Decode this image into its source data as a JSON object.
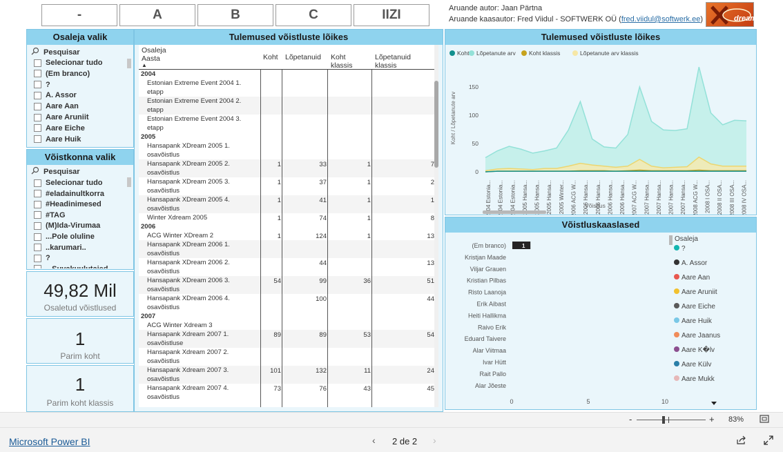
{
  "top_buttons": [
    "-",
    "A",
    "B",
    "C",
    "IIZI"
  ],
  "author": {
    "line1": "Aruande autor: Jaan Pärtna",
    "line2_prefix": "Aruande kaasautor: Fred Viidul - SOFTWERK OÜ (",
    "email": "fred.viidul@softwerk.ee",
    "line2_suffix": ")"
  },
  "logo_text": "dream",
  "participant_slicer": {
    "title": "Osaleja valik",
    "search": "Pesquisar",
    "items": [
      "Selecionar tudo",
      "(Em branco)",
      "?",
      "A. Assor",
      "Aare Aan",
      "Aare Aruniit",
      "Aare Eiche",
      "Aare Huik"
    ]
  },
  "competition_slicer": {
    "title": "Võistkonna valik",
    "search": "Pesquisar",
    "items": [
      "Selecionar tudo",
      "#eladainultkorra",
      "#Headinimesed",
      "#TAG",
      "(M)Ida-Virumaa",
      "...Pole oluline",
      "..karumari..",
      "?",
      "...Suvakuulutaied ..."
    ]
  },
  "kpis": [
    {
      "value": "49,82 Mil",
      "label": "Osaletud võistlused"
    },
    {
      "value": "1",
      "label": "Parim koht"
    },
    {
      "value": "1",
      "label": "Parim koht klassis"
    }
  ],
  "table": {
    "title": "Tulemused võistluste lõikes",
    "header_col1_line1": "Osaleja",
    "header_col1_line2": "Aasta",
    "columns": [
      "Koht",
      "Lõpetanuid",
      "Koht klassis",
      "Lõpetanuid klassis"
    ],
    "rows": [
      {
        "type": "year",
        "label": "2004"
      },
      {
        "type": "event",
        "label": "Estonian Extreme Event 2004 1.",
        "label2": "etapp",
        "vals": [
          "",
          "",
          "",
          ""
        ]
      },
      {
        "type": "event",
        "label": "Estonian Extreme Event 2004 2.",
        "label2": "etapp",
        "vals": [
          "",
          "",
          "",
          ""
        ]
      },
      {
        "type": "event",
        "label": "Estonian Extreme Event 2004 3.",
        "label2": "etapp",
        "vals": [
          "",
          "",
          "",
          ""
        ]
      },
      {
        "type": "year",
        "label": "2005"
      },
      {
        "type": "event",
        "label": "Hansapank XDream 2005 1.",
        "label2": "osavõistlus",
        "vals": [
          "",
          "",
          "",
          ""
        ]
      },
      {
        "type": "event",
        "label": "Hansapank XDream 2005 2.",
        "label2": "osavõistlus",
        "vals": [
          "1",
          "33",
          "1",
          "7"
        ]
      },
      {
        "type": "event",
        "label": "Hansapank XDream 2005 3.",
        "label2": "osavõistlus",
        "vals": [
          "1",
          "37",
          "1",
          "2"
        ]
      },
      {
        "type": "event",
        "label": "Hansapank XDream 2005 4.",
        "label2": "osavõistlus",
        "vals": [
          "1",
          "41",
          "1",
          "1"
        ]
      },
      {
        "type": "event1",
        "label": "Winter Xdream 2005",
        "vals": [
          "1",
          "74",
          "1",
          "8"
        ]
      },
      {
        "type": "year",
        "label": "2006"
      },
      {
        "type": "event1",
        "label": "ACG Winter XDream 2",
        "vals": [
          "1",
          "124",
          "1",
          "13"
        ]
      },
      {
        "type": "event",
        "label": "Hansapank XDream 2006 1.",
        "label2": "osavõistlus",
        "vals": [
          "",
          "",
          "",
          ""
        ]
      },
      {
        "type": "event",
        "label": "Hansapank XDream 2006 2.",
        "label2": "osavõistlus",
        "vals": [
          "",
          "44",
          "",
          "13"
        ]
      },
      {
        "type": "event",
        "label": "Hansapank XDream 2006 3.",
        "label2": "osavõistlus",
        "vals": [
          "54",
          "99",
          "36",
          "51"
        ]
      },
      {
        "type": "event",
        "label": "Hansapank XDream 2006 4.",
        "label2": "osavõistlus",
        "vals": [
          "",
          "100",
          "",
          "44"
        ]
      },
      {
        "type": "year",
        "label": "2007"
      },
      {
        "type": "event1",
        "label": "ACG Winter Xdream 3",
        "vals": [
          "",
          "",
          "",
          ""
        ]
      },
      {
        "type": "event",
        "label": "Hansapank Xdream 2007 1.",
        "label2": "osavõistluse",
        "vals": [
          "89",
          "89",
          "53",
          "54"
        ]
      },
      {
        "type": "event",
        "label": "Hansapank Xdream 2007 2.",
        "label2": "osavõistlus",
        "vals": [
          "",
          "",
          "",
          ""
        ]
      },
      {
        "type": "event",
        "label": "Hansapank Xdream 2007 3.",
        "label2": "osavõistlus",
        "vals": [
          "101",
          "132",
          "11",
          "24"
        ]
      },
      {
        "type": "event",
        "label": "Hansapank Xdream 2007 4.",
        "label2": "osavõistlus",
        "vals": [
          "73",
          "76",
          "43",
          "45"
        ]
      }
    ]
  },
  "chart_data": {
    "type": "area",
    "title": "Tulemused võistluste lõikes",
    "legend": [
      "Koht",
      "Lõpetanute arv",
      "Koht klassis",
      "Lõpetanute arv klassis"
    ],
    "legend_colors": [
      "#12908e",
      "#93e1d8",
      "#c7a31e",
      "#f6e7a6"
    ],
    "legend_position": "top-left",
    "xlabel": "Võistlus",
    "ylabel": "Koht / Lõpetanute arv",
    "yticks": [
      "0",
      "50",
      "100",
      "150"
    ],
    "ylim": [
      0,
      190
    ],
    "categories": [
      "2004 Estonia...",
      "2004 Estonia...",
      "2004 Estonia...",
      "2005 Hansa...",
      "2005 Hansa...",
      "2005 Hansa...",
      "2005 Winter...",
      "2006 ACG W...",
      "2006 Hansa...",
      "2006 Hansa...",
      "2006 Hansa...",
      "2006 Hansa...",
      "2007 ACG W...",
      "2007 Hansa...",
      "2007 Hansa...",
      "2007 Hansa...",
      "2007 Hansa...",
      "2008 ACG W...",
      "2008 I OSA...",
      "2008 II OSA...",
      "2008 III OSA...",
      "2008 IV OSA..."
    ],
    "series": [
      {
        "name": "Lõpetanute arv",
        "values": [
          25,
          37,
          45,
          40,
          33,
          37,
          42,
          74,
          124,
          58,
          44,
          42,
          66,
          150,
          89,
          74,
          73,
          76,
          185,
          104,
          83,
          91,
          90
        ]
      },
      {
        "name": "Lõpetanute arv klassis",
        "values": [
          2,
          5,
          6,
          5,
          4,
          6,
          6,
          10,
          15,
          12,
          10,
          8,
          10,
          22,
          10,
          7,
          8,
          9,
          26,
          14,
          10,
          10,
          10
        ]
      },
      {
        "name": "Koht klassis",
        "values": [
          0,
          1,
          1,
          1,
          1,
          1,
          1,
          1,
          2,
          2,
          2,
          1,
          2,
          3,
          2,
          2,
          2,
          2,
          3,
          2,
          2,
          2,
          2
        ]
      },
      {
        "name": "Koht",
        "values": [
          0,
          1,
          1,
          1,
          1,
          1,
          1,
          1,
          1,
          1,
          1,
          1,
          1,
          1,
          1,
          1,
          1,
          1,
          1,
          1,
          1,
          1,
          1
        ]
      }
    ]
  },
  "partners": {
    "title": "Võistluskaaslased",
    "names": [
      "(Em branco)",
      "Kristjan Maade",
      "Viljar Grauen",
      "Kristian Pilbas",
      "Risto Laanoja",
      "Erik Aibast",
      "Heiti Hallikma",
      "Raivo Erik",
      "Eduard Taivere",
      "Alar Viitmaa",
      "Ivar Hütt",
      "Rait Pallo",
      "Alar Jõeste"
    ],
    "values": [
      1
    ],
    "value_label": "1",
    "xticks": [
      "0",
      "5",
      "10"
    ],
    "legend_title": "Osaleja",
    "legend": [
      {
        "name": "?",
        "color": "#12b5b0"
      },
      {
        "name": "A. Assor",
        "color": "#333333"
      },
      {
        "name": "Aare Aan",
        "color": "#e8584f"
      },
      {
        "name": "Aare Aruniit",
        "color": "#f2c12e"
      },
      {
        "name": "Aare Eiche",
        "color": "#5a5a5a"
      },
      {
        "name": "Aare Huik",
        "color": "#7ac8e6"
      },
      {
        "name": "Aare Jaanus",
        "color": "#f08c5a"
      },
      {
        "name": "Aare K�lv",
        "color": "#8c4f8f"
      },
      {
        "name": "Aare Külv",
        "color": "#2a7fa8"
      },
      {
        "name": "Aare Mukk",
        "color": "#e6b8b8"
      }
    ]
  },
  "zoom": {
    "minus": "-",
    "plus": "+",
    "level": "83%"
  },
  "footer": {
    "brand": "Microsoft Power BI",
    "page": "2 de 2"
  }
}
